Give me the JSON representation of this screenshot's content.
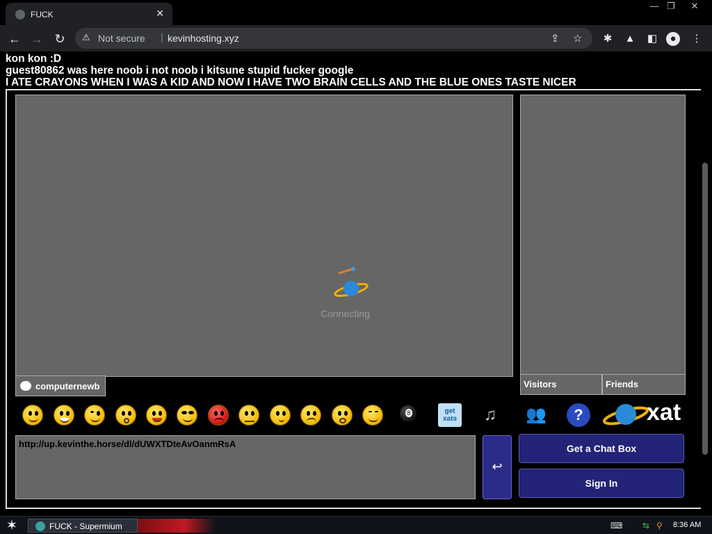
{
  "browser": {
    "tab_title": "FUCK",
    "tab_close": "✕",
    "window_controls": [
      "—",
      "❐",
      "✕"
    ],
    "security_label": "Not secure",
    "separator": "|",
    "url": "kevinhosting.xyz"
  },
  "page": {
    "messages": [
      "kon kon :D",
      "guest80862 was here noob i not noob i kitsune stupid fucker google",
      "I ATE CRAYONS WHEN I WAS A KID AND NOW I HAVE TWO BRAIN CELLS AND THE BLUE ONES TASTE NICER"
    ]
  },
  "chat": {
    "status": "Connecting",
    "user_tab": "computernewb",
    "visitors_tab": "Visitors",
    "friends_tab": "Friends",
    "input_value": "http://up.kevinthe.horse/dl/dUWXTDteAvOanmRsA",
    "send_symbol": "↩",
    "get_chat_box": "Get a Chat Box",
    "sign_in": "Sign In",
    "logo_text": "xat",
    "get_xats": "get xats",
    "help_symbol": "?",
    "eight_ball": "8"
  },
  "taskbar": {
    "task_label": "FUCK - Supermium",
    "clock": "8:36 AM"
  }
}
